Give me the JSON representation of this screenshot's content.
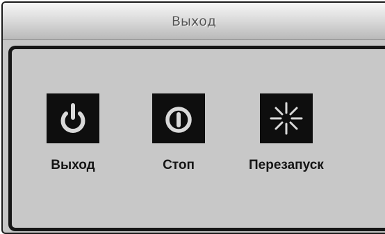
{
  "dialog": {
    "title": "Выход"
  },
  "actions": [
    {
      "label": "Выход",
      "icon": "power-icon"
    },
    {
      "label": "Стоп",
      "icon": "stop-icon"
    },
    {
      "label": "Перезапуск",
      "icon": "restart-icon"
    }
  ],
  "colors": {
    "dialog_bg": "#c6c6c6",
    "icon_tile_bg": "#0e0e0e",
    "icon_glyph": "#d9d9d9",
    "label_text": "#151515"
  }
}
